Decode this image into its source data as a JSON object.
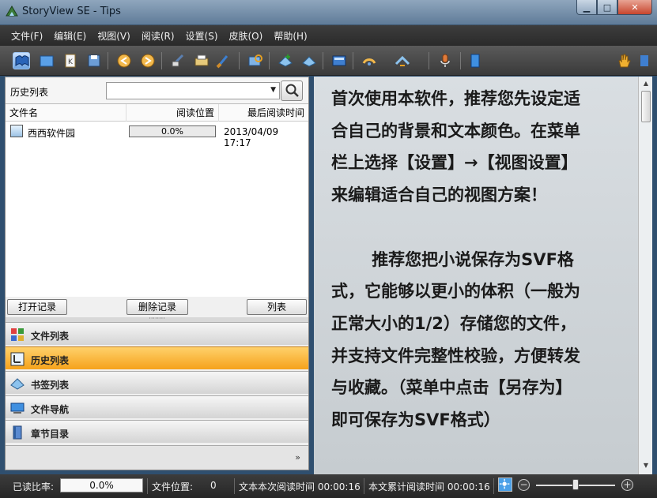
{
  "window": {
    "title": "StoryView SE - Tips",
    "minimize": "▁",
    "maximize": "□",
    "close": "✕"
  },
  "menu": [
    "文件(F)",
    "编辑(E)",
    "视图(V)",
    "阅读(R)",
    "设置(S)",
    "皮肤(O)",
    "帮助(H)"
  ],
  "toolbar": {
    "icons": [
      "open-book-icon",
      "folder-icon",
      "bookmark-k-icon",
      "save-icon",
      "back-icon",
      "forward-icon",
      "typing-icon",
      "print-icon",
      "brush-icon",
      "search-book-icon",
      "add-bookmark-icon",
      "bookmark-list-icon",
      "fullscreen-icon",
      "auto-scroll-icon",
      "scroll-speed-icon",
      "microphone-icon",
      "page-layout-icon",
      "zoom-out-icon",
      "zoom-in-icon",
      "hand-icon"
    ],
    "zoom_level": 0.6
  },
  "history_panel": {
    "title": "历史列表",
    "search_value": "",
    "columns": [
      "文件名",
      "阅读位置",
      "最后阅读时间"
    ],
    "rows": [
      {
        "name": "西西软件园",
        "progress": "0.0%",
        "last_read": "2013/04/09 17:17"
      }
    ],
    "buttons": {
      "open": "打开记录",
      "delete": "删除记录",
      "list": "列表"
    }
  },
  "nav": {
    "items": [
      {
        "label": "文件列表",
        "icon": "file-list-icon",
        "active": false
      },
      {
        "label": "历史列表",
        "icon": "history-icon",
        "active": true
      },
      {
        "label": "书签列表",
        "icon": "bookmark-list-icon",
        "active": false
      },
      {
        "label": "文件导航",
        "icon": "file-nav-icon",
        "active": false
      },
      {
        "label": "章节目录",
        "icon": "chapter-icon",
        "active": false
      }
    ],
    "expand": "»"
  },
  "reader": {
    "text": "首次使用本软件，推荐您先设定适\n合自己的背景和文本颜色。在菜单\n栏上选择【设置】→【视图设置】\n来编辑适合自己的视图方案！\n\n       推荐您把小说保存为SVF格\n式，它能够以更小的体积（一般为\n正常大小的1/2）存储您的文件，\n并支持文件完整性校验，方便转发\n与收藏。（菜单中点击【另存为】\n即可保存为SVF格式）"
  },
  "status": {
    "read_ratio_label": "已读比率:",
    "read_ratio_value": "0.0%",
    "file_pos_label": "文件位置:",
    "file_pos_value": "0",
    "session_time": "文本本次阅读时间 00:00:16",
    "total_time": "本文累计阅读时间 00:00:16",
    "brightness_level": 0.5
  },
  "colors": {
    "active_nav": "#f5a21b",
    "reader_bg": "#d3d8dc",
    "toolbar_bg": "#4a4a4a"
  }
}
